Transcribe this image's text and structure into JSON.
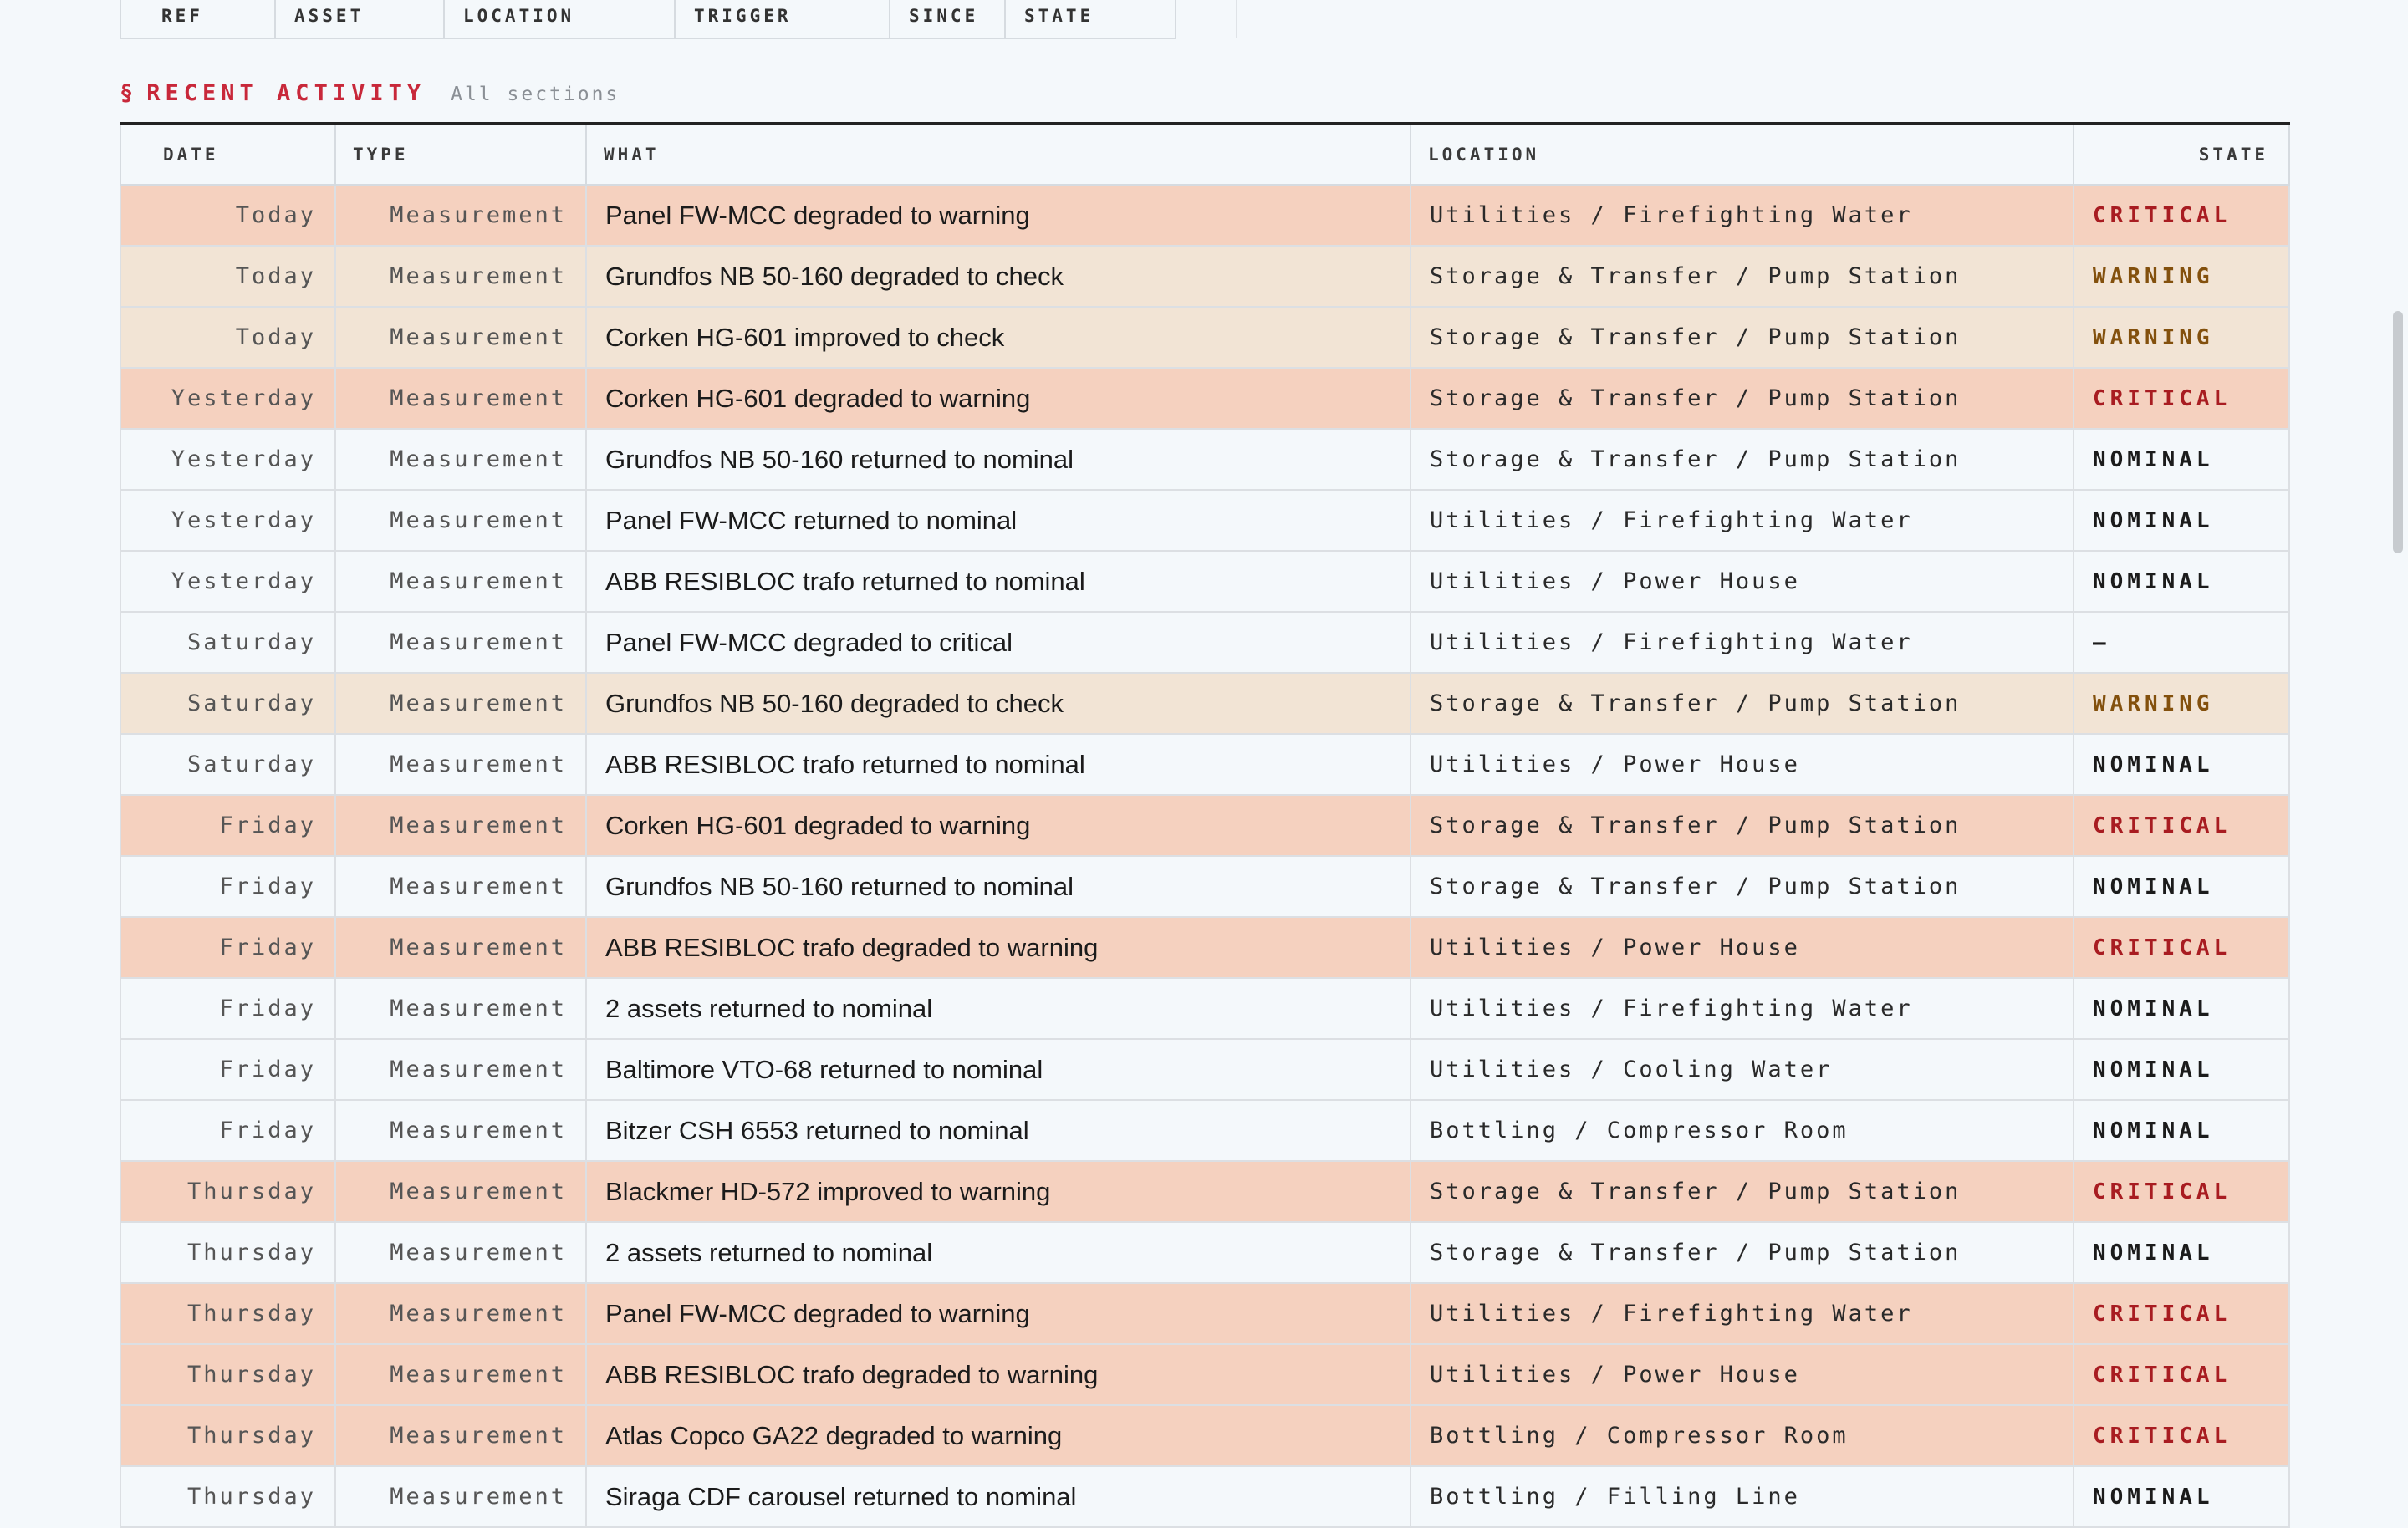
{
  "top_table": {
    "columns": [
      "REF",
      "ASSET",
      "LOCATION",
      "TRIGGER",
      "SINCE",
      "STATE"
    ]
  },
  "section": {
    "glyph": "§",
    "title": "RECENT ACTIVITY",
    "subtitle": "All sections"
  },
  "activity": {
    "columns": {
      "date": "DATE",
      "type": "TYPE",
      "what": "WHAT",
      "location": "LOCATION",
      "state": "STATE"
    },
    "rows": [
      {
        "date": "Today",
        "type": "Measurement",
        "what": "Panel FW-MCC degraded to warning",
        "location": "Utilities / Firefighting Water",
        "state": "CRITICAL",
        "level": "critical"
      },
      {
        "date": "Today",
        "type": "Measurement",
        "what": "Grundfos NB 50-160 degraded to check",
        "location": "Storage & Transfer / Pump Station",
        "state": "WARNING",
        "level": "warning"
      },
      {
        "date": "Today",
        "type": "Measurement",
        "what": "Corken HG-601 improved to check",
        "location": "Storage & Transfer / Pump Station",
        "state": "WARNING",
        "level": "warning"
      },
      {
        "date": "Yesterday",
        "type": "Measurement",
        "what": "Corken HG-601 degraded to warning",
        "location": "Storage & Transfer / Pump Station",
        "state": "CRITICAL",
        "level": "critical"
      },
      {
        "date": "Yesterday",
        "type": "Measurement",
        "what": "Grundfos NB 50-160 returned to nominal",
        "location": "Storage & Transfer / Pump Station",
        "state": "NOMINAL",
        "level": "nominal"
      },
      {
        "date": "Yesterday",
        "type": "Measurement",
        "what": "Panel FW-MCC returned to nominal",
        "location": "Utilities / Firefighting Water",
        "state": "NOMINAL",
        "level": "nominal"
      },
      {
        "date": "Yesterday",
        "type": "Measurement",
        "what": "ABB RESIBLOC trafo returned to nominal",
        "location": "Utilities / Power House",
        "state": "NOMINAL",
        "level": "nominal"
      },
      {
        "date": "Saturday",
        "type": "Measurement",
        "what": "Panel FW-MCC degraded to critical",
        "location": "Utilities / Firefighting Water",
        "state": "–",
        "level": "none"
      },
      {
        "date": "Saturday",
        "type": "Measurement",
        "what": "Grundfos NB 50-160 degraded to check",
        "location": "Storage & Transfer / Pump Station",
        "state": "WARNING",
        "level": "warning"
      },
      {
        "date": "Saturday",
        "type": "Measurement",
        "what": "ABB RESIBLOC trafo returned to nominal",
        "location": "Utilities / Power House",
        "state": "NOMINAL",
        "level": "nominal"
      },
      {
        "date": "Friday",
        "type": "Measurement",
        "what": "Corken HG-601 degraded to warning",
        "location": "Storage & Transfer / Pump Station",
        "state": "CRITICAL",
        "level": "critical"
      },
      {
        "date": "Friday",
        "type": "Measurement",
        "what": "Grundfos NB 50-160 returned to nominal",
        "location": "Storage & Transfer / Pump Station",
        "state": "NOMINAL",
        "level": "nominal"
      },
      {
        "date": "Friday",
        "type": "Measurement",
        "what": "ABB RESIBLOC trafo degraded to warning",
        "location": "Utilities / Power House",
        "state": "CRITICAL",
        "level": "critical"
      },
      {
        "date": "Friday",
        "type": "Measurement",
        "what": "2 assets returned to nominal",
        "location": "Utilities / Firefighting Water",
        "state": "NOMINAL",
        "level": "nominal"
      },
      {
        "date": "Friday",
        "type": "Measurement",
        "what": "Baltimore VTO-68 returned to nominal",
        "location": "Utilities / Cooling Water",
        "state": "NOMINAL",
        "level": "nominal"
      },
      {
        "date": "Friday",
        "type": "Measurement",
        "what": "Bitzer CSH 6553 returned to nominal",
        "location": "Bottling / Compressor Room",
        "state": "NOMINAL",
        "level": "nominal"
      },
      {
        "date": "Thursday",
        "type": "Measurement",
        "what": "Blackmer HD-572 improved to warning",
        "location": "Storage & Transfer / Pump Station",
        "state": "CRITICAL",
        "level": "critical"
      },
      {
        "date": "Thursday",
        "type": "Measurement",
        "what": "2 assets returned to nominal",
        "location": "Storage & Transfer / Pump Station",
        "state": "NOMINAL",
        "level": "nominal"
      },
      {
        "date": "Thursday",
        "type": "Measurement",
        "what": "Panel FW-MCC degraded to warning",
        "location": "Utilities / Firefighting Water",
        "state": "CRITICAL",
        "level": "critical"
      },
      {
        "date": "Thursday",
        "type": "Measurement",
        "what": "ABB RESIBLOC trafo degraded to warning",
        "location": "Utilities / Power House",
        "state": "CRITICAL",
        "level": "critical"
      },
      {
        "date": "Thursday",
        "type": "Measurement",
        "what": "Atlas Copco GA22 degraded to warning",
        "location": "Bottling / Compressor Room",
        "state": "CRITICAL",
        "level": "critical"
      },
      {
        "date": "Thursday",
        "type": "Measurement",
        "what": "Siraga CDF carousel returned to nominal",
        "location": "Bottling / Filling Line",
        "state": "NOMINAL",
        "level": "nominal"
      }
    ]
  },
  "colors": {
    "background": "#f4f8fb",
    "accent": "#c8283a",
    "critical_row": "#f5d1bf",
    "warning_row": "#f2e4d5",
    "critical_text": "#a81c21",
    "warning_text": "#83500d"
  }
}
